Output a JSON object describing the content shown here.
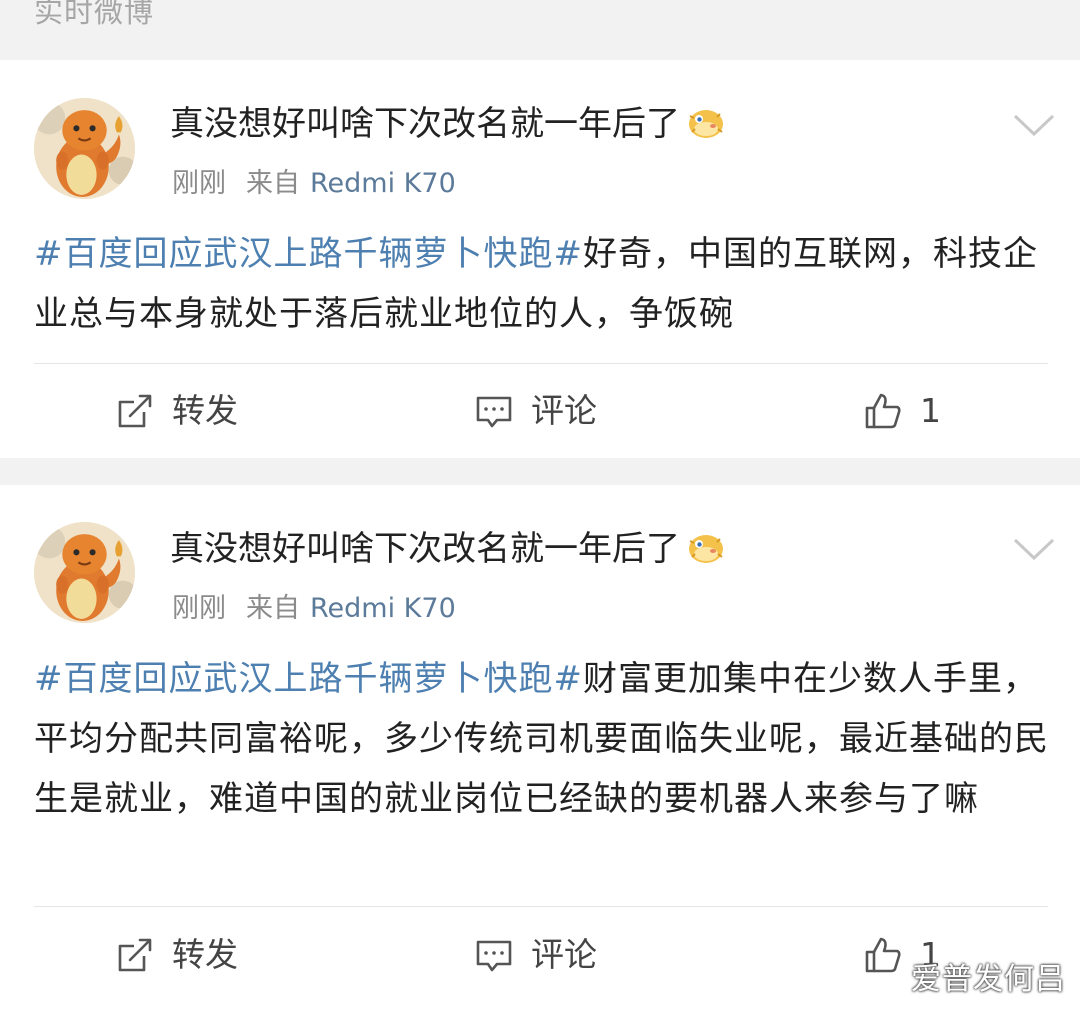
{
  "section": {
    "title": "实时微博"
  },
  "posts": [
    {
      "user": {
        "name": "真没想好叫啥下次改名就一年后了",
        "avatar_icon": "charmander-avatar",
        "badge_icon": "pufferfish-emoji"
      },
      "time": "刚刚",
      "source_prefix": "来自",
      "device": "Redmi K70",
      "hashtag": "#百度回应武汉上路千辆萝卜快跑#",
      "text": "好奇，中国的互联网，科技企业总与本身就处于落后就业地位的人，争饭碗",
      "actions": {
        "repost": "转发",
        "comment": "评论",
        "like_count": "1"
      }
    },
    {
      "user": {
        "name": "真没想好叫啥下次改名就一年后了",
        "avatar_icon": "charmander-avatar",
        "badge_icon": "pufferfish-emoji"
      },
      "time": "刚刚",
      "source_prefix": "来自",
      "device": "Redmi K70",
      "hashtag": "#百度回应武汉上路千辆萝卜快跑#",
      "text": "财富更加集中在少数人手里，平均分配共同富裕呢，多少传统司机要面临失业呢，最近基础的民生是就业，难道中国的就业岗位已经缺的要机器人来参与了嘛",
      "actions": {
        "repost": "转发",
        "comment": "评论",
        "like_count": "1"
      }
    }
  ],
  "watermark": "爱普发何吕",
  "colors": {
    "hashtag": "#4d7fb0",
    "device": "#5c7a99",
    "background": "#f2f2f2"
  }
}
